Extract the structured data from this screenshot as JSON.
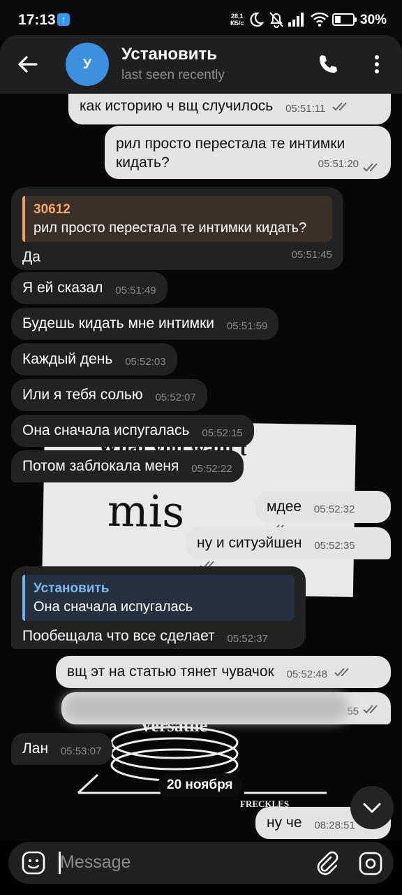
{
  "status_bar": {
    "time": "17:13",
    "app_badge": "↑",
    "net_speed_value": "28,1",
    "net_speed_unit": "КБ/с",
    "battery": "30%"
  },
  "header": {
    "avatar_letter": "У",
    "title": "Установить",
    "subtitle": "last seen recently"
  },
  "messages": [
    {
      "dir": "out",
      "text": "как историю ч вщ случилось",
      "time": "05:51:11"
    },
    {
      "dir": "out",
      "text": "рил просто перестала те интимки кидать?",
      "time": "05:51:20"
    },
    {
      "dir": "in",
      "reply_name": "30612",
      "reply_text": "рил просто перестала те интимки кидать?",
      "text": "Да",
      "time": "05:51:45"
    },
    {
      "dir": "in",
      "text": "Я ей сказал",
      "time": "05:51:49"
    },
    {
      "dir": "in",
      "text": "Будешь кидать мне интимки",
      "time": "05:51:59"
    },
    {
      "dir": "in",
      "text": "Каждый день",
      "time": "05:52:03"
    },
    {
      "dir": "in",
      "text": "Или я тебя солью",
      "time": "05:52:07"
    },
    {
      "dir": "in",
      "text": "Она сначала испугалась",
      "time": "05:52:15"
    },
    {
      "dir": "in",
      "text": "Потом заблокала меня",
      "time": "05:52:22"
    },
    {
      "dir": "out",
      "text": "мдее",
      "time": "05:52:32"
    },
    {
      "dir": "out",
      "text": "ну и ситуэйшен",
      "time": "05:52:35"
    },
    {
      "dir": "in",
      "reply_name": "Установить",
      "reply_text": "Она сначала испугалась",
      "text": "Пообещала что все сделает",
      "time": "05:52:37"
    },
    {
      "dir": "out",
      "text": "вщ эт на статью тянет чувачок",
      "time": "05:52:48"
    },
    {
      "dir": "out",
      "text": "",
      "time": "55"
    },
    {
      "dir": "in",
      "text": "Лан",
      "time": "05:53:07"
    },
    {
      "dir": "out",
      "text": "ну че",
      "time": "08:28:51"
    }
  ],
  "date_separator": "20 ноября",
  "sticker": {
    "text": "What you want t",
    "handwriting": "mis",
    "text2": "Versatile",
    "brand": "FRECKLES"
  },
  "composer": {
    "placeholder": "Message"
  },
  "icons": {
    "back": "arrow-left-icon",
    "call": "phone-icon",
    "more": "more-vertical-icon",
    "emoji": "emoji-icon",
    "attach": "paperclip-icon",
    "camera": "camera-icon",
    "scroll": "chevron-down-icon"
  }
}
